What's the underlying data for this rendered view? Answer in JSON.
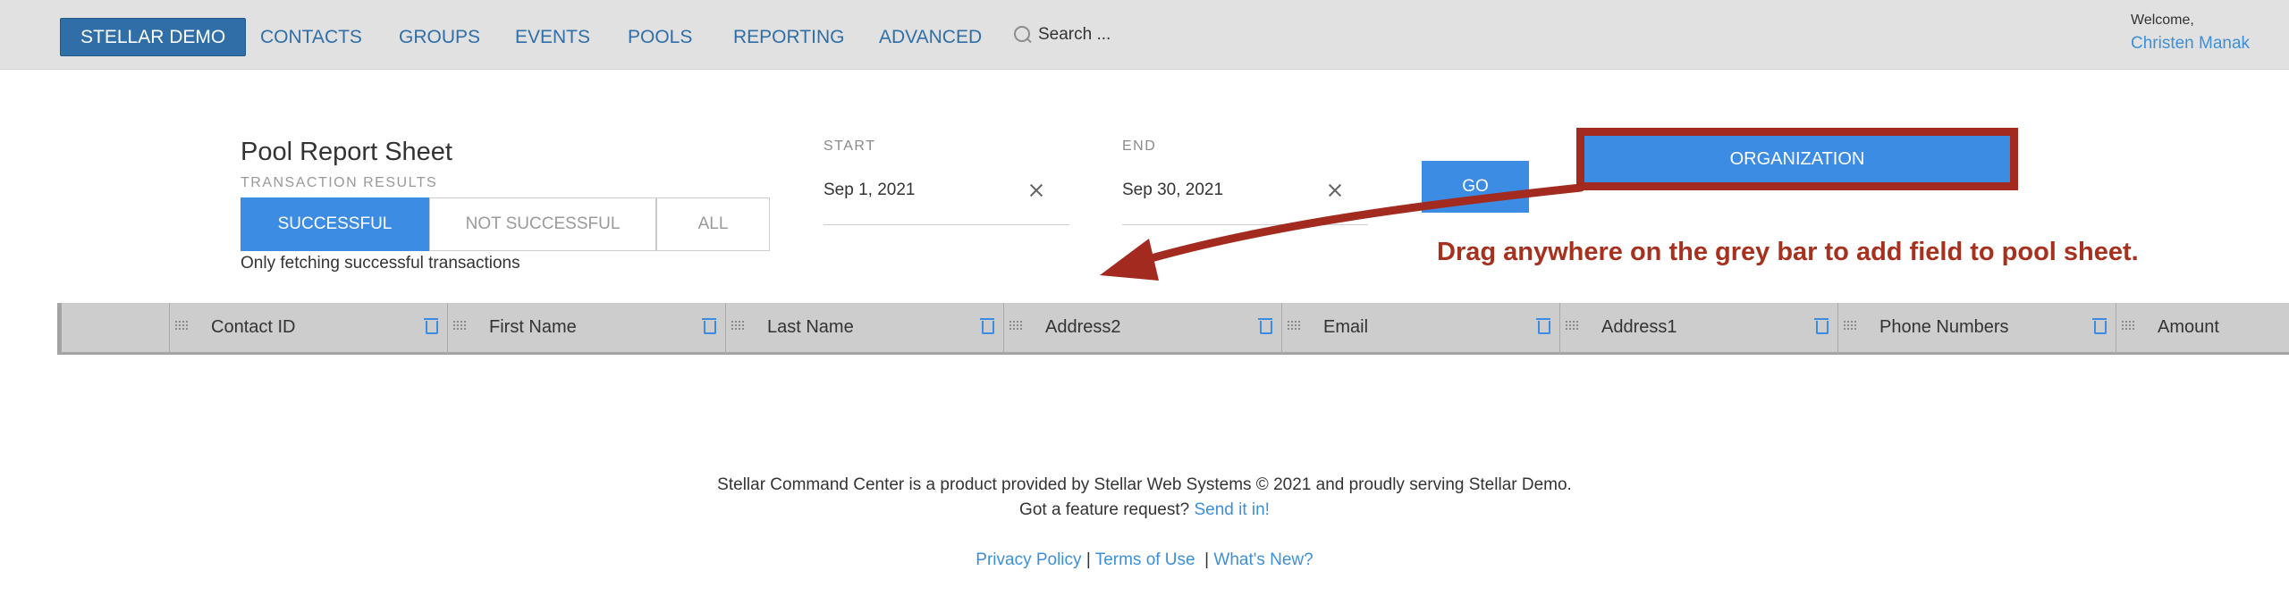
{
  "nav": {
    "brand": "STELLAR DEMO",
    "items": [
      "CONTACTS",
      "GROUPS",
      "EVENTS",
      "POOLS",
      "REPORTING",
      "ADVANCED"
    ],
    "search_placeholder": "Search ...",
    "welcome": "Welcome,",
    "user_name": "Christen Manak"
  },
  "sheet": {
    "title": "Pool Report Sheet",
    "subtitle": "TRANSACTION RESULTS",
    "filters": [
      "SUCCESSFUL",
      "NOT SUCCESSFUL",
      "ALL"
    ],
    "selected_filter": "SUCCESSFUL",
    "note": "Only fetching successful transactions",
    "start_label": "START",
    "start_value": "Sep 1, 2021",
    "end_label": "END",
    "end_value": "Sep 30, 2021",
    "go_label": "GO",
    "dragged_field": "ORGANIZATION",
    "hint": "Drag anywhere on the grey bar to add field to pool sheet.",
    "columns": [
      "Contact ID",
      "First Name",
      "Last Name",
      "Address2",
      "Email",
      "Address1",
      "Phone Numbers",
      "Amount"
    ]
  },
  "footer": {
    "line1": "Stellar Command Center is a product provided by Stellar Web Systems © 2021 and proudly serving Stellar Demo.",
    "line2_text": "Got a feature request?",
    "line2_link": "Send it in!",
    "privacy": "Privacy Policy",
    "terms": "Terms of Use",
    "whats_new": "What's New?"
  },
  "colors": {
    "brand": "#2f6ea7",
    "accent": "#3d8ce4",
    "annotation": "#a7311f"
  }
}
